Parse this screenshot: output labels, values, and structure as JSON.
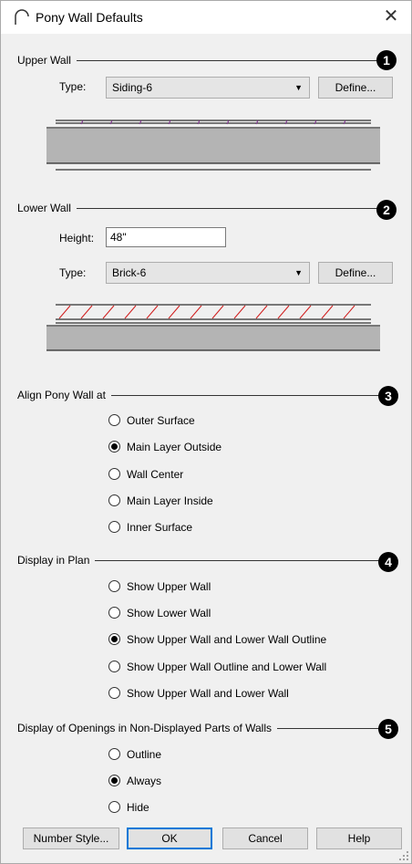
{
  "window": {
    "title": "Pony Wall Defaults",
    "close_glyph": "✕"
  },
  "upper_wall": {
    "title": "Upper Wall",
    "badge": "1",
    "type_label": "Type:",
    "type_value": "Siding-6",
    "define_label": "Define..."
  },
  "lower_wall": {
    "title": "Lower Wall",
    "badge": "2",
    "height_label": "Height:",
    "height_value": "48\"",
    "type_label": "Type:",
    "type_value": "Brick-6",
    "define_label": "Define..."
  },
  "align": {
    "title": "Align Pony Wall at",
    "badge": "3",
    "options": [
      {
        "label": "Outer Surface",
        "checked": false
      },
      {
        "label": "Main Layer Outside",
        "checked": true
      },
      {
        "label": "Wall Center",
        "checked": false
      },
      {
        "label": "Main Layer Inside",
        "checked": false
      },
      {
        "label": "Inner Surface",
        "checked": false
      }
    ]
  },
  "display": {
    "title": "Display in Plan",
    "badge": "4",
    "options": [
      {
        "label": "Show Upper Wall",
        "checked": false
      },
      {
        "label": "Show Lower Wall",
        "checked": false
      },
      {
        "label": "Show Upper Wall and Lower Wall Outline",
        "checked": true
      },
      {
        "label": "Show Upper Wall Outline and Lower Wall",
        "checked": false
      },
      {
        "label": "Show Upper Wall and Lower Wall",
        "checked": false
      }
    ]
  },
  "openings": {
    "title": "Display of Openings in Non-Displayed Parts of Walls",
    "badge": "5",
    "options": [
      {
        "label": "Outline",
        "checked": false
      },
      {
        "label": "Always",
        "checked": true
      },
      {
        "label": "Hide",
        "checked": false
      }
    ]
  },
  "buttons": {
    "number_style": "Number Style...",
    "ok": "OK",
    "cancel": "Cancel",
    "help": "Help"
  },
  "colors": {
    "wall_fill": "#b4b4b4",
    "siding_hatch": "#7d2e8c",
    "brick_hatch": "#d01c1c",
    "focus_border": "#0078d7"
  },
  "icons": {
    "title": "arch-icon",
    "dropdown": "chevron-down-icon",
    "grip": "resize-grip-icon"
  }
}
